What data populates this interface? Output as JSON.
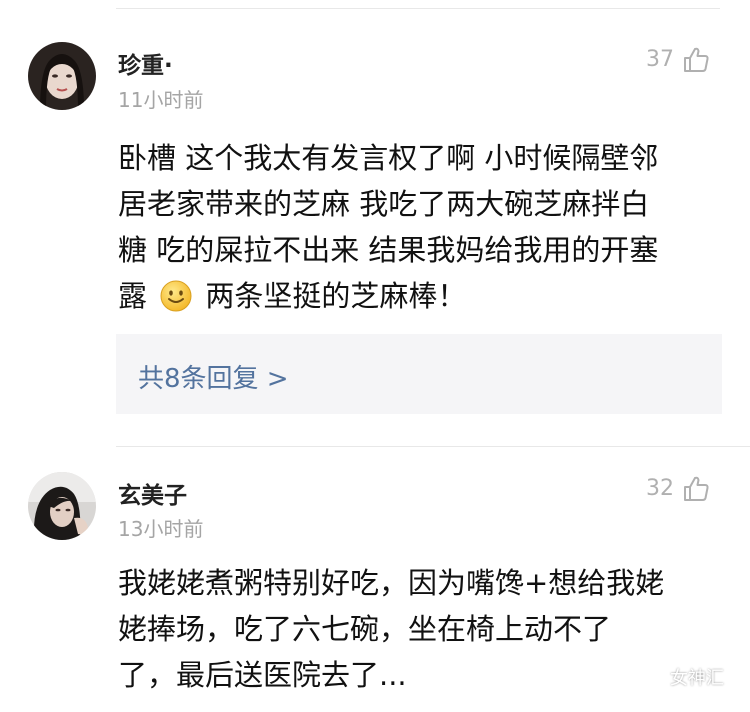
{
  "comments": [
    {
      "username": "珍重·",
      "time": "11小时前",
      "likes": "37",
      "lines": [
        "卧槽 这个我太有发言权了啊  小时候隔壁邻",
        "居老家带来的芝麻 我吃了两大碗芝麻拌白",
        "糖 吃的屎拉不出来  结果我妈给我用的开塞"
      ],
      "last_line_before_emoji": "露 ",
      "last_line_after_emoji": " 两条坚挺的芝麻棒！",
      "replies_link": "共8条回复 >"
    },
    {
      "username": "玄美子",
      "time": "13小时前",
      "likes": "32",
      "lines": [
        "我姥姥煮粥特别好吃，因为嘴馋+想给我姥",
        "姥捧场，吃了六七碗，坐在椅上动不了",
        "了，最后送医院去了..."
      ]
    }
  ],
  "icons": {
    "like": "thumbs-up-icon",
    "emoji": "smile-emoji-icon",
    "watermark": "wechat-icon"
  },
  "watermark": {
    "text": "女神汇"
  },
  "colors": {
    "username": "#222222",
    "timestamp": "#a5a5a5",
    "like": "#b0b0b0",
    "link": "#53739e",
    "reply_bg": "#f5f5f7"
  }
}
